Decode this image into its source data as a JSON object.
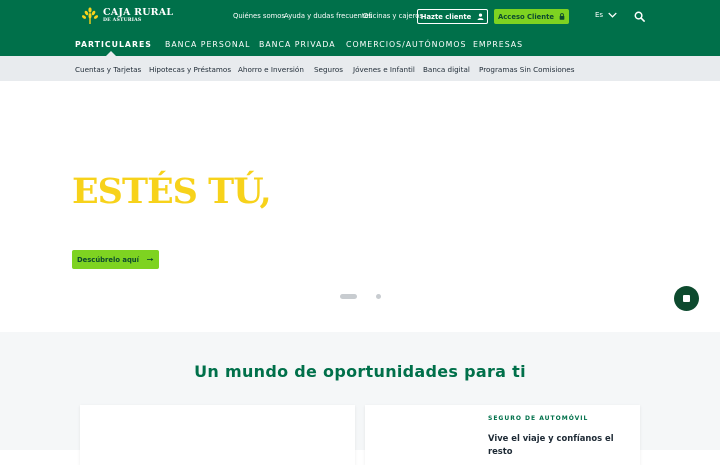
{
  "brand": {
    "name_line1": "CAJA RURAL",
    "name_line2": "DE ASTURIAS",
    "colors": {
      "primary": "#00704a",
      "accent": "#7ed321",
      "hero_title": "#f7d21b",
      "dark": "#0d4a2e"
    }
  },
  "top_links": [
    "Quiénes somos",
    "Ayuda y dudas frecuentes",
    "Oficinas y cajeros"
  ],
  "buttons": {
    "hazte_cliente": {
      "label": "Hazte cliente",
      "icon": "user-icon"
    },
    "acceso_cliente": {
      "label": "Acceso Cliente",
      "icon": "lock-icon"
    }
  },
  "language": {
    "value": "Es",
    "icon": "chevron-down-icon"
  },
  "search": {
    "icon": "search-icon"
  },
  "main_nav": [
    "PARTICULARES",
    "BANCA PERSONAL",
    "BANCA PRIVADA",
    "COMERCIOS/AUTÓNOMOS",
    "EMPRESAS"
  ],
  "main_nav_active": "PARTICULARES",
  "sub_nav": [
    "Cuentas y Tarjetas",
    "Hipotecas y Préstamos",
    "Ahorro e Inversión",
    "Seguros",
    "Jóvenes e Infantil",
    "Banca digital",
    "Programas Sin Comisiones"
  ],
  "hero": {
    "title": "ESTÉS TÚ,",
    "cta_label": "Descúbrelo aquí",
    "cta_icon": "arrow-right-icon",
    "slide_count": 2,
    "active_slide": 1,
    "pause_icon": "stop-icon"
  },
  "section": {
    "title": "Un mundo de oportunidades para ti",
    "cards": [
      {
        "eyebrow": "",
        "headline": ""
      },
      {
        "eyebrow": "SEGURO DE AUTOMÓVIL",
        "headline": "Vive el viaje y confíanos el resto"
      }
    ]
  }
}
